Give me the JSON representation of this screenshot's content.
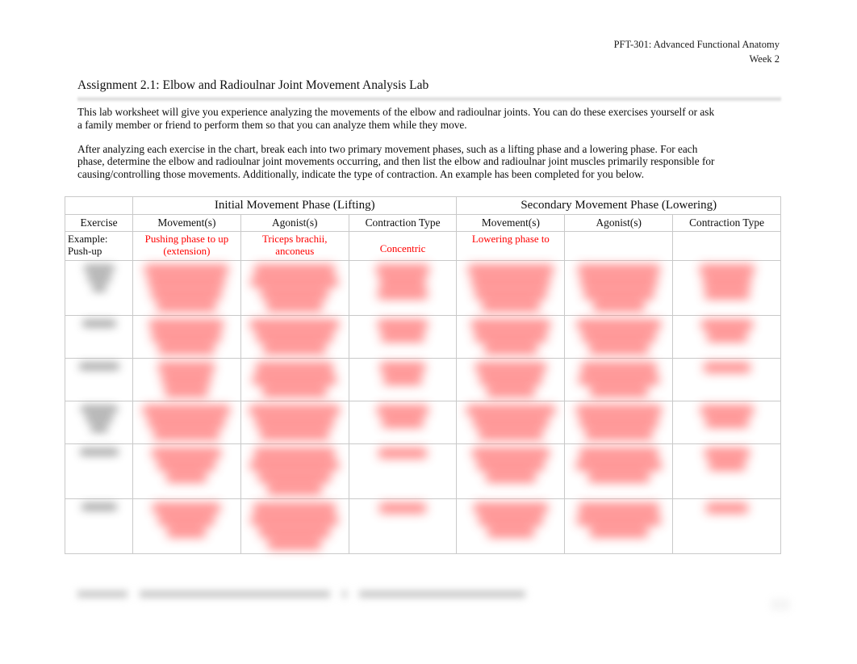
{
  "document": {
    "running_header": {
      "course": "PFT-301: Advanced Functional Anatomy",
      "week": "Week 2"
    },
    "title": "Assignment 2.1: Elbow and Radioulnar Joint Movement Analysis Lab",
    "paragraphs": [
      "This lab worksheet will give you experience analyzing the movements of the elbow and radioulnar joints. You can do these exercises yourself or ask a family member or friend to perform them so that you can analyze them while they move.",
      "After analyzing each exercise in the chart, break each into two primary movement phases, such as a lifting phase and a lowering phase. For each phase, determine the elbow and radioulnar joint movements occurring, and then list the elbow and radioulnar joint muscles primarily responsible for causing/controlling those movements. Additionally, indicate the type of contraction. An example has been completed for you below."
    ]
  },
  "table": {
    "phase_headers": {
      "initial": "Initial Movement Phase (Lifting)",
      "secondary": "Secondary Movement Phase (Lowering)"
    },
    "column_headers": {
      "exercise": "Exercise",
      "movements_initial": "Movement(s)",
      "agonists_initial": "Agonist(s)",
      "contraction_initial": "Contraction Type",
      "movements_secondary": "Movement(s)",
      "agonists_secondary": "Agonist(s)",
      "contraction_secondary": "Contraction Type"
    },
    "example_row": {
      "exercise_line1": "Example:",
      "exercise_line2": "Push-up",
      "movement_initial": "Pushing phase to up (extension)",
      "agonist_initial": "Triceps brachii, anconeus",
      "contraction_initial": "Concentric",
      "movement_secondary": "Lowering phase to",
      "agonist_secondary": "",
      "contraction_secondary": ""
    },
    "blurred_row_count": 6,
    "blurred_note": "Remaining worksheet rows are visually redacted/blurred in the source image and their text is not legible."
  },
  "footer": {
    "blurred_note": "Footer text is visually redacted/blurred and not legible.",
    "page_number": ""
  },
  "colors": {
    "answer_red": "#ff0000",
    "text_black": "#0d0d0d",
    "table_border": "#c9c9c9",
    "page_background": "#ffffff"
  }
}
